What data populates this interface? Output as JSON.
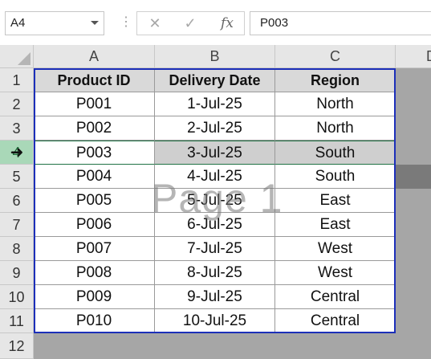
{
  "formula_bar": {
    "name_box": "A4",
    "cancel_icon": "✕",
    "enter_icon": "✓",
    "fx_label": "fx",
    "formula_value": "P003"
  },
  "columns": [
    "A",
    "B",
    "C",
    "D"
  ],
  "rows": [
    "1",
    "2",
    "3",
    "4",
    "5",
    "6",
    "7",
    "8",
    "9",
    "10",
    "11",
    "12"
  ],
  "selected_row": "4",
  "table": {
    "headers": [
      "Product ID",
      "Delivery Date",
      "Region"
    ],
    "data": [
      [
        "P001",
        "1-Jul-25",
        "North"
      ],
      [
        "P002",
        "2-Jul-25",
        "North"
      ],
      [
        "P003",
        "3-Jul-25",
        "South"
      ],
      [
        "P004",
        "4-Jul-25",
        "South"
      ],
      [
        "P005",
        "5-Jul-25",
        "East"
      ],
      [
        "P006",
        "6-Jul-25",
        "East"
      ],
      [
        "P007",
        "7-Jul-25",
        "West"
      ],
      [
        "P008",
        "8-Jul-25",
        "West"
      ],
      [
        "P009",
        "9-Jul-25",
        "Central"
      ],
      [
        "P010",
        "10-Jul-25",
        "Central"
      ]
    ]
  },
  "watermark": "Page 1",
  "colors": {
    "print_area_border": "#1c2fb9",
    "selected_row_header": "#a9d8b8",
    "page_break_gray": "#a6a6a6"
  }
}
